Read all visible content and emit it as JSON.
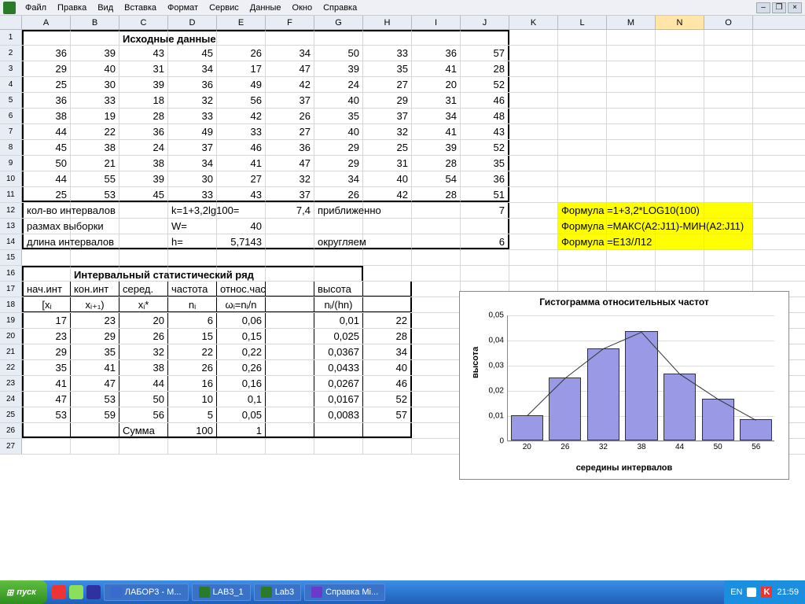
{
  "menu": [
    "Файл",
    "Правка",
    "Вид",
    "Вставка",
    "Формат",
    "Сервис",
    "Данные",
    "Окно",
    "Справка"
  ],
  "cols": [
    "A",
    "B",
    "C",
    "D",
    "E",
    "F",
    "G",
    "H",
    "I",
    "J",
    "K",
    "L",
    "M",
    "N",
    "O"
  ],
  "title_raw": "Исходные данные",
  "raw": [
    [
      36,
      39,
      43,
      45,
      26,
      34,
      50,
      33,
      36,
      57
    ],
    [
      29,
      40,
      31,
      34,
      17,
      47,
      39,
      35,
      41,
      28
    ],
    [
      25,
      30,
      39,
      36,
      49,
      42,
      24,
      27,
      20,
      52
    ],
    [
      36,
      33,
      18,
      32,
      56,
      37,
      40,
      29,
      31,
      46
    ],
    [
      38,
      19,
      28,
      33,
      42,
      26,
      35,
      37,
      34,
      48
    ],
    [
      44,
      22,
      36,
      49,
      33,
      27,
      40,
      32,
      41,
      43
    ],
    [
      45,
      38,
      24,
      37,
      46,
      36,
      29,
      25,
      39,
      52
    ],
    [
      50,
      21,
      38,
      34,
      41,
      47,
      29,
      31,
      28,
      35
    ],
    [
      44,
      55,
      39,
      30,
      27,
      32,
      34,
      40,
      54,
      36
    ],
    [
      25,
      53,
      45,
      33,
      43,
      37,
      26,
      42,
      28,
      51
    ]
  ],
  "r12": {
    "a": "кол-во интервалов",
    "d": "k=1+3,2lg100=",
    "f": "7,4",
    "g": "приближенно",
    "j": "7"
  },
  "r13": {
    "a": "размах выборки",
    "d": "W=",
    "e": "40"
  },
  "r14": {
    "a": "длина интервалов",
    "d": "h=",
    "e": "5,7143",
    "g": "округляем",
    "j": "6"
  },
  "formulas": [
    "Формула =1+3,2*LOG10(100)",
    "Формула =МАКС(A2:J11)-МИН(A2:J11)",
    "Формула =Е13/Л12"
  ],
  "title_int": "Интервальный статистический ряд",
  "hdr17": [
    "нач.инт",
    "кон.инт",
    "серед.",
    "частота",
    "относ.частота",
    "",
    "высота",
    ""
  ],
  "hdr18": [
    "[xᵢ",
    "xᵢ₊₁)",
    "xᵢ*",
    "nᵢ",
    "ωᵢ=nᵢ/n",
    "",
    "nᵢ/(hn)",
    ""
  ],
  "introws": [
    [
      "17",
      "23",
      "20",
      "6",
      "0,06",
      "",
      "0,01",
      "22"
    ],
    [
      "23",
      "29",
      "26",
      "15",
      "0,15",
      "",
      "0,025",
      "28"
    ],
    [
      "29",
      "35",
      "32",
      "22",
      "0,22",
      "",
      "0,0367",
      "34"
    ],
    [
      "35",
      "41",
      "38",
      "26",
      "0,26",
      "",
      "0,0433",
      "40"
    ],
    [
      "41",
      "47",
      "44",
      "16",
      "0,16",
      "",
      "0,0267",
      "46"
    ],
    [
      "47",
      "53",
      "50",
      "10",
      "0,1",
      "",
      "0,0167",
      "52"
    ],
    [
      "53",
      "59",
      "56",
      "5",
      "0,05",
      "",
      "0,0083",
      "57"
    ]
  ],
  "sumrow": [
    "",
    "",
    "Сумма",
    "100",
    "1",
    "",
    "",
    ""
  ],
  "chart_data": {
    "type": "bar",
    "title": "Гистограмма относительных частот",
    "xlabel": "середины интервалов",
    "ylabel": "высота",
    "categories": [
      20,
      26,
      32,
      38,
      44,
      50,
      56
    ],
    "values": [
      0.01,
      0.025,
      0.0367,
      0.0433,
      0.0267,
      0.0167,
      0.0083
    ],
    "ylim": [
      0,
      0.05
    ],
    "yticks": [
      0,
      0.01,
      0.02,
      0.03,
      0.04,
      0.05
    ]
  },
  "taskbar": {
    "start": "пуск",
    "items": [
      "ЛАБОР3 - М...",
      "LAB3_1",
      "Lab3",
      "Справка Mi..."
    ],
    "lang": "EN",
    "time": "21:59"
  }
}
